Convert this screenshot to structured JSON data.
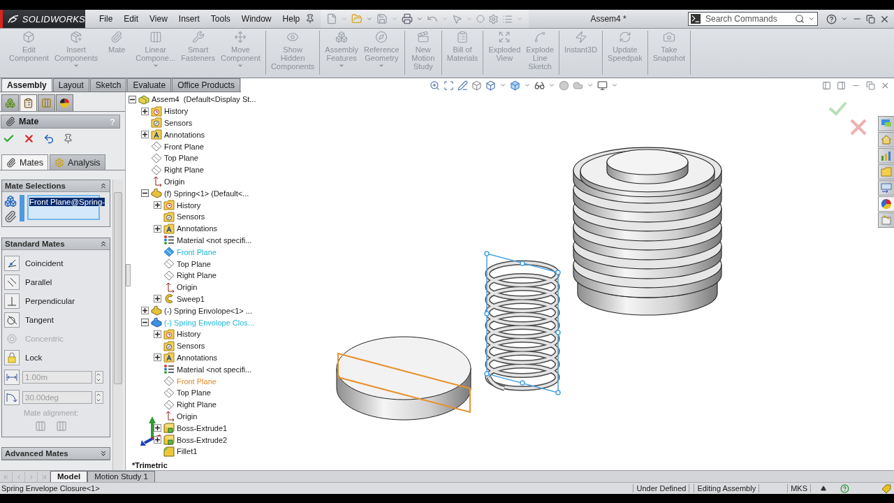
{
  "app": {
    "logo": "**SOLID**WORKS"
  },
  "menu": [
    "File",
    "Edit",
    "View",
    "Insert",
    "Tools",
    "Window",
    "Help"
  ],
  "document_title": "Assem4 *",
  "search": {
    "placeholder": "Search Commands"
  },
  "command_groups": [
    {
      "commands": [
        {
          "label": "Edit\nComponent",
          "dropdown": false
        },
        {
          "label": "Insert\nComponents",
          "dropdown": true
        },
        {
          "label": "Mate",
          "dropdown": false
        },
        {
          "label": "Linear\nCompone...",
          "dropdown": true
        },
        {
          "label": "Smart\nFasteners",
          "dropdown": false
        },
        {
          "label": "Move\nComponent",
          "dropdown": true
        }
      ]
    },
    {
      "commands": [
        {
          "label": "Show\nHidden\nComponents",
          "dropdown": false
        }
      ]
    },
    {
      "commands": [
        {
          "label": "Assembly\nFeatures",
          "dropdown": true
        },
        {
          "label": "Reference\nGeometry",
          "dropdown": true
        }
      ]
    },
    {
      "commands": [
        {
          "label": "New\nMotion\nStudy",
          "dropdown": false
        }
      ]
    },
    {
      "commands": [
        {
          "label": "Bill of\nMaterials",
          "dropdown": false
        }
      ]
    },
    {
      "commands": [
        {
          "label": "Exploded\nView",
          "dropdown": false
        },
        {
          "label": "Explode\nLine\nSketch",
          "dropdown": false
        }
      ]
    },
    {
      "commands": [
        {
          "label": "Instant3D",
          "dropdown": false
        }
      ]
    },
    {
      "commands": [
        {
          "label": "Update\nSpeedpak",
          "dropdown": false
        }
      ]
    },
    {
      "commands": [
        {
          "label": "Take\nSnapshot",
          "dropdown": false
        }
      ]
    }
  ],
  "command_tabs": [
    {
      "label": "Assembly",
      "selected": true
    },
    {
      "label": "Layout",
      "selected": false
    },
    {
      "label": "Sketch",
      "selected": false
    },
    {
      "label": "Evaluate",
      "selected": false
    },
    {
      "label": "Office Products",
      "selected": false
    }
  ],
  "property_manager": {
    "icon_tabs": [
      {
        "selected": false
      },
      {
        "selected": true
      },
      {
        "selected": false
      },
      {
        "selected": false
      }
    ],
    "title": "Mate",
    "help": "?",
    "tabs": [
      {
        "label": "Mates",
        "selected": true
      },
      {
        "label": "Analysis",
        "selected": false
      }
    ],
    "mate_selections": {
      "title": "Mate Selections",
      "expanded": true,
      "items": [
        {
          "label": "Front Plane@Spring-",
          "selected": true
        }
      ]
    },
    "standard_mates": {
      "title": "Standard Mates",
      "expanded": true,
      "mates": [
        {
          "label": "Coincident",
          "disabled": false
        },
        {
          "label": "Parallel",
          "disabled": false
        },
        {
          "label": "Perpendicular",
          "disabled": false
        },
        {
          "label": "Tangent",
          "disabled": false
        },
        {
          "label": "Concentric",
          "disabled": true
        },
        {
          "label": "Lock",
          "disabled": false
        }
      ],
      "distance": {
        "value": "1.00m",
        "disabled": true
      },
      "angle": {
        "value": "30.00deg",
        "disabled": true
      },
      "alignment_label": "Mate alignment:"
    },
    "advanced_mates": {
      "title": "Advanced Mates",
      "expanded": false
    }
  },
  "tree": {
    "label": "Assem4  (Default<Display St...",
    "kind": "assembly",
    "expandable": true,
    "expanded": true,
    "selected": false,
    "highlighted": false,
    "children": [
      {
        "label": "History",
        "kind": "history",
        "expandable": true,
        "expanded": false,
        "selected": false,
        "highlighted": false
      },
      {
        "label": "Sensors",
        "kind": "sensors",
        "expandable": false,
        "selected": false,
        "highlighted": false
      },
      {
        "label": "Annotations",
        "kind": "annotations",
        "expandable": true,
        "expanded": false,
        "selected": false,
        "highlighted": false
      },
      {
        "label": "Front Plane",
        "kind": "plane",
        "expandable": false,
        "selected": false,
        "highlighted": false
      },
      {
        "label": "Top Plane",
        "kind": "plane",
        "expandable": false,
        "selected": false,
        "highlighted": false
      },
      {
        "label": "Right Plane",
        "kind": "plane",
        "expandable": false,
        "selected": false,
        "highlighted": false
      },
      {
        "label": "Origin",
        "kind": "origin",
        "expandable": false,
        "selected": false,
        "highlighted": false
      },
      {
        "label": "(f) Spring<1> (Default<...",
        "kind": "component",
        "expandable": true,
        "expanded": true,
        "selected": false,
        "highlighted": false,
        "children": [
          {
            "label": "History",
            "kind": "history",
            "expandable": true,
            "expanded": false,
            "selected": false,
            "highlighted": false
          },
          {
            "label": "Sensors",
            "kind": "sensors",
            "expandable": false,
            "selected": false,
            "highlighted": false
          },
          {
            "label": "Annotations",
            "kind": "annotations",
            "expandable": true,
            "expanded": false,
            "selected": false,
            "highlighted": false
          },
          {
            "label": "Material <not specifi...",
            "kind": "material",
            "expandable": false,
            "selected": false,
            "highlighted": false
          },
          {
            "label": "Front Plane",
            "kind": "plane",
            "expandable": false,
            "selected": true,
            "highlighted": false
          },
          {
            "label": "Top Plane",
            "kind": "plane",
            "expandable": false,
            "selected": false,
            "highlighted": false
          },
          {
            "label": "Right Plane",
            "kind": "plane",
            "expandable": false,
            "selected": false,
            "highlighted": false
          },
          {
            "label": "Origin",
            "kind": "origin",
            "expandable": false,
            "selected": false,
            "highlighted": false
          },
          {
            "label": "Sweep1",
            "kind": "sweep",
            "expandable": true,
            "expanded": false,
            "selected": false,
            "highlighted": false
          }
        ]
      },
      {
        "label": "(-) Spring Envolope<1> ...",
        "kind": "component",
        "expandable": true,
        "expanded": false,
        "selected": false,
        "highlighted": false
      },
      {
        "label": "(-) Spring Envolope Clos...",
        "kind": "component",
        "expandable": true,
        "expanded": true,
        "selected": true,
        "highlighted": false,
        "children": [
          {
            "label": "History",
            "kind": "history",
            "expandable": true,
            "expanded": false,
            "selected": false,
            "highlighted": false
          },
          {
            "label": "Sensors",
            "kind": "sensors",
            "expandable": false,
            "selected": false,
            "highlighted": false
          },
          {
            "label": "Annotations",
            "kind": "annotations",
            "expandable": true,
            "expanded": false,
            "selected": false,
            "highlighted": false
          },
          {
            "label": "Material <not specifi...",
            "kind": "material",
            "expandable": false,
            "selected": false,
            "highlighted": false
          },
          {
            "label": "Front Plane",
            "kind": "plane",
            "expandable": false,
            "selected": false,
            "highlighted": true
          },
          {
            "label": "Top Plane",
            "kind": "plane",
            "expandable": false,
            "selected": false,
            "highlighted": false
          },
          {
            "label": "Right Plane",
            "kind": "plane",
            "expandable": false,
            "selected": false,
            "highlighted": false
          },
          {
            "label": "Origin",
            "kind": "origin",
            "expandable": false,
            "selected": false,
            "highlighted": false
          },
          {
            "label": "Boss-Extrude1",
            "kind": "extrude",
            "expandable": true,
            "expanded": false,
            "selected": false,
            "highlighted": false
          },
          {
            "label": "Boss-Extrude2",
            "kind": "extrude",
            "expandable": true,
            "expanded": false,
            "selected": false,
            "highlighted": false
          },
          {
            "label": "Fillet1",
            "kind": "fillet",
            "expandable": false,
            "selected": false,
            "highlighted": false
          }
        ]
      }
    ]
  },
  "view_name": "*Trimetric",
  "task_pane_tabs": [
    {
      "selected": false
    },
    {
      "selected": false
    },
    {
      "selected": false
    },
    {
      "selected": false
    },
    {
      "selected": false
    },
    {
      "selected": true
    },
    {
      "selected": false
    }
  ],
  "bottom_tabs": [
    {
      "label": "Model",
      "selected": true
    },
    {
      "label": "Motion Study 1",
      "selected": false
    }
  ],
  "status_bar": {
    "message": "Spring Envelope Closure<1>",
    "fields": [
      "Under Defined",
      "Editing Assembly",
      "MKS"
    ]
  }
}
